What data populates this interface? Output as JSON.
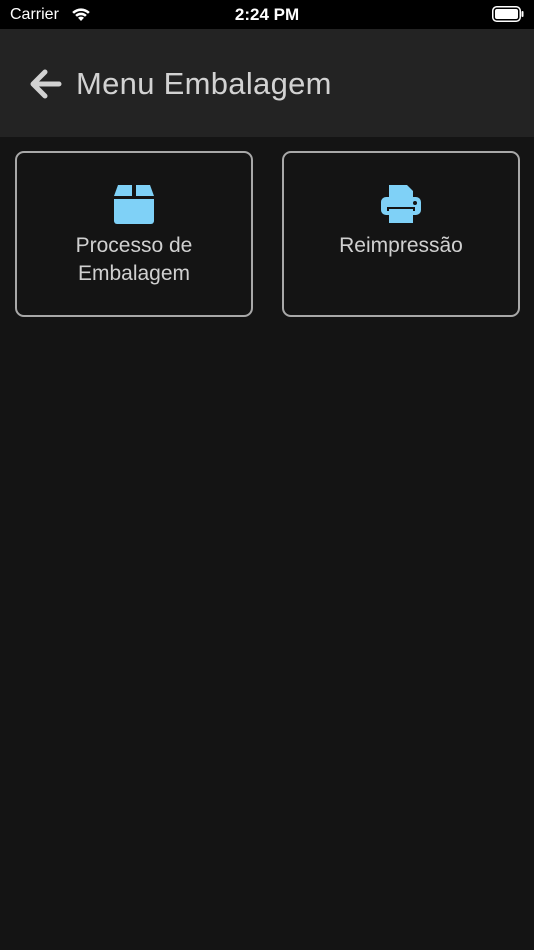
{
  "status_bar": {
    "carrier": "Carrier",
    "time": "2:24 PM",
    "wifi_icon": "wifi-icon",
    "battery_icon": "battery-icon"
  },
  "header": {
    "back_icon": "arrow-left-icon",
    "title": "Menu Embalagem",
    "background": "#232323"
  },
  "menu": {
    "items": [
      {
        "label": "Processo de\nEmbalagem",
        "icon": "box-icon"
      },
      {
        "label": "Reimpressão",
        "icon": "printer-icon"
      }
    ]
  },
  "colors": {
    "background": "#141414",
    "accent_icon": "#7fd1f7",
    "tile_border": "#a8a8a8",
    "text": "#d0d0d0"
  }
}
